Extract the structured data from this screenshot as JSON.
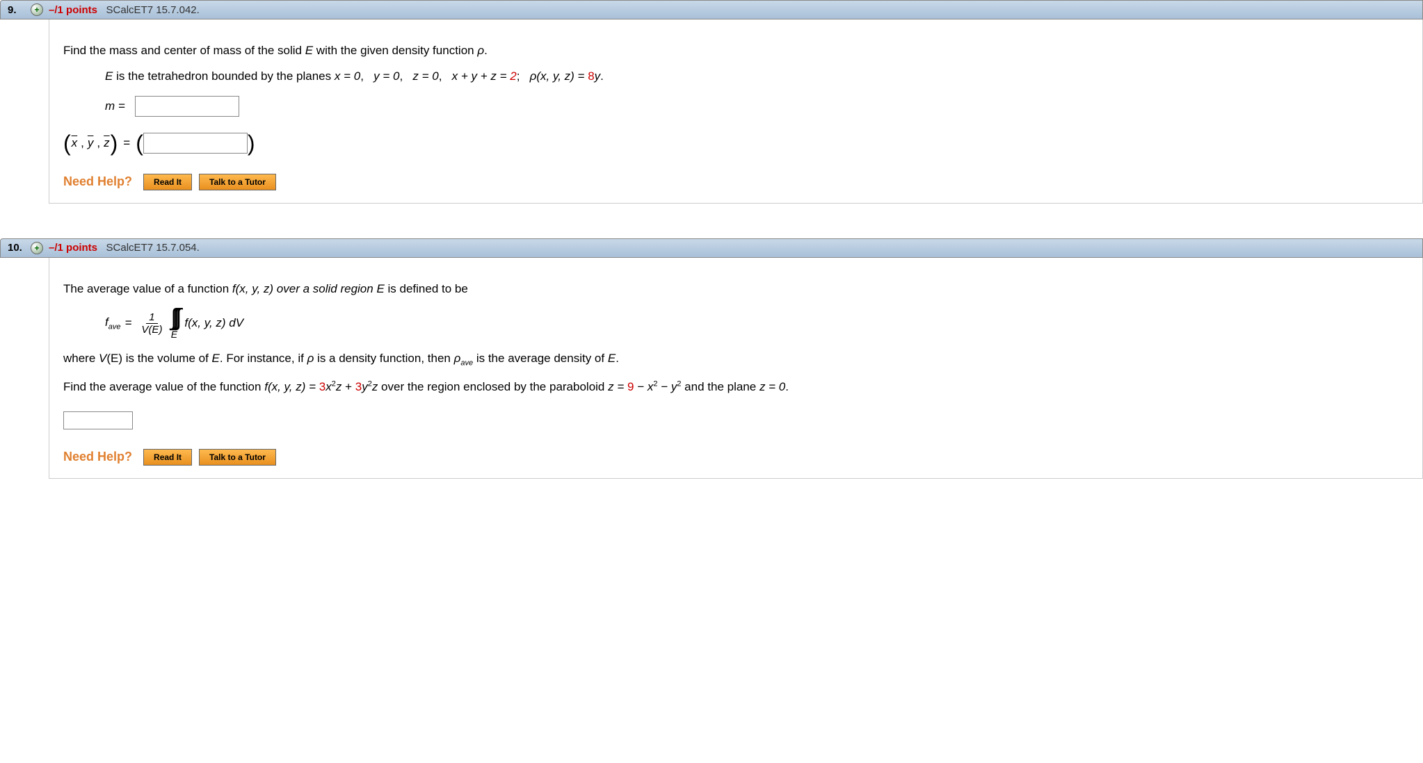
{
  "questions": [
    {
      "number": "9.",
      "expand_symbol": "+",
      "points_prefix": "–/1",
      "points_label": "points",
      "source": "SCalcET7 15.7.042.",
      "prompt_a": "Find the mass and center of mass of the solid ",
      "prompt_E": "E",
      "prompt_b": " with the given density function ",
      "prompt_rho": "ρ",
      "prompt_c": ".",
      "desc_a": "E",
      "desc_b": " is the tetrahedron bounded by the planes  ",
      "eqx": "x = 0",
      "eqy": "y = 0",
      "eqz": "z = 0",
      "eqplane_a": "x + y + z = ",
      "eqplane_val": "2",
      "rho_def_a": "ρ",
      "rho_def_b": "(x, y, z) = ",
      "rho_def_val": "8",
      "rho_def_c": "y",
      "m_label": "m =",
      "com_x": "x",
      "com_y": "y",
      "com_z": "z",
      "com_eq": "=",
      "need_help": "Need Help?",
      "read_it": "Read It",
      "talk": "Talk to a Tutor"
    },
    {
      "number": "10.",
      "expand_symbol": "+",
      "points_prefix": "–/1",
      "points_label": "points",
      "source": "SCalcET7 15.7.054.",
      "p1_a": "The average value of a function  ",
      "p1_f": "f",
      "p1_b": "(x, y, z)  over a solid region ",
      "p1_E": "E",
      "p1_c": " is defined to be",
      "fave": "f",
      "fave_sub": "ave",
      "frac_num": "1",
      "frac_den_a": "V",
      "frac_den_b": "(E)",
      "int_sub": "E",
      "int_fn_a": "f",
      "int_fn_b": "(x, y, z) dV",
      "p2_a": "where  ",
      "p2_v": "V",
      "p2_b": "(E)  is the volume of ",
      "p2_E": "E",
      "p2_c": ". For instance, if ",
      "p2_rho": "ρ",
      "p2_d": " is a density function, then  ",
      "p2_rho2": "ρ",
      "p2_rho2_sub": "ave",
      "p2_e": "  is the average density of ",
      "p2_E2": "E",
      "p2_f": ".",
      "p3_a": "Find the average value of the function  ",
      "p3_f": "f",
      "p3_b": "(x, y, z) = ",
      "p3_c1": "3",
      "p3_t1": "x",
      "p3_e1": "2",
      "p3_t1b": "z",
      "p3_plus": " + ",
      "p3_c2": "3",
      "p3_t2": "y",
      "p3_e2": "2",
      "p3_t2b": "z",
      "p3_c": "  over the region enclosed by the paraboloid  ",
      "p3_para_a": "z = ",
      "p3_para_val": "9",
      "p3_para_b": " − x",
      "p3_para_e1": "2",
      "p3_para_c": " − y",
      "p3_para_e2": "2",
      "p3_d": "  and the plane  ",
      "p3_plane": "z = 0",
      "p3_e": ".",
      "need_help": "Need Help?",
      "read_it": "Read It",
      "talk": "Talk to a Tutor"
    }
  ]
}
